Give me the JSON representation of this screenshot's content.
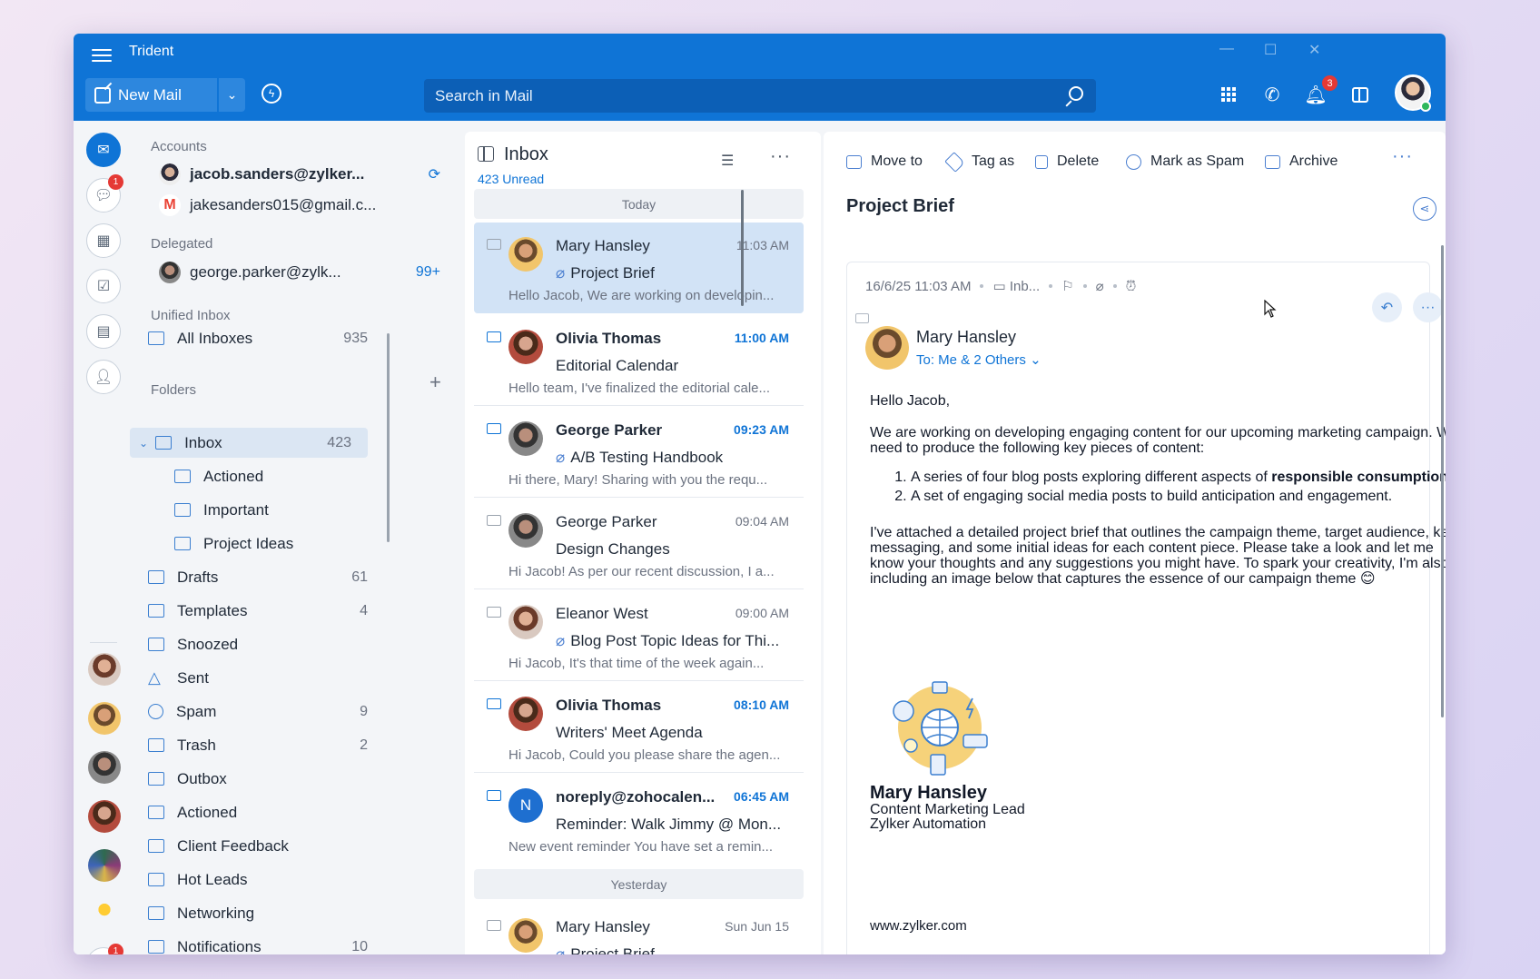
{
  "app": {
    "title": "Trident"
  },
  "toolbar": {
    "new_mail_label": "New Mail",
    "search_placeholder": "Search in Mail",
    "notification_count": "3"
  },
  "rail": {
    "chat_badge": "1",
    "bottom_badge": "1"
  },
  "accounts": {
    "header": "Accounts",
    "items": [
      {
        "label": "jacob.sanders@zylker...",
        "extra": ""
      },
      {
        "label": "jakesanders015@gmail.c...",
        "extra": ""
      }
    ]
  },
  "delegated": {
    "header": "Delegated",
    "items": [
      {
        "label": "george.parker@zylk...",
        "extra": "99+"
      }
    ]
  },
  "unified": {
    "header": "Unified Inbox",
    "items": [
      {
        "label": "All Inboxes",
        "count": "935"
      }
    ]
  },
  "folders": {
    "header": "Folders",
    "items": [
      {
        "label": "Inbox",
        "count": "423"
      },
      {
        "label": "Actioned",
        "count": ""
      },
      {
        "label": "Important",
        "count": ""
      },
      {
        "label": "Project Ideas",
        "count": ""
      },
      {
        "label": "Drafts",
        "count": "61"
      },
      {
        "label": "Templates",
        "count": "4"
      },
      {
        "label": "Snoozed",
        "count": ""
      },
      {
        "label": "Sent",
        "count": ""
      },
      {
        "label": "Spam",
        "count": "9"
      },
      {
        "label": "Trash",
        "count": "2"
      },
      {
        "label": "Outbox",
        "count": ""
      },
      {
        "label": "Actioned",
        "count": ""
      },
      {
        "label": "Client Feedback",
        "count": ""
      },
      {
        "label": "Hot Leads",
        "count": ""
      },
      {
        "label": "Networking",
        "count": ""
      },
      {
        "label": "Notifications",
        "count": "10"
      }
    ]
  },
  "list": {
    "title": "Inbox",
    "unread": "423 Unread",
    "today": "Today",
    "yesterday": "Yesterday",
    "messages": [
      {
        "from": "Mary Hansley",
        "time": "11:03 AM",
        "subject": "Project Brief",
        "preview": "Hello Jacob, We are working on developin..."
      },
      {
        "from": "Olivia Thomas",
        "time": "11:00 AM",
        "subject": "Editorial Calendar",
        "preview": "Hello team, I've finalized the editorial cale..."
      },
      {
        "from": "George Parker",
        "time": "09:23 AM",
        "subject": "A/B Testing Handbook",
        "preview": "Hi there, Mary! Sharing with you the requ..."
      },
      {
        "from": "George Parker",
        "time": "09:04 AM",
        "subject": "Design Changes",
        "preview": "Hi Jacob! As per our recent discussion, I a..."
      },
      {
        "from": "Eleanor West",
        "time": "09:00 AM",
        "subject": "Blog Post Topic Ideas for Thi...",
        "preview": "Hi Jacob, It's that time of the week again..."
      },
      {
        "from": "Olivia Thomas",
        "time": "08:10 AM",
        "subject": "Writers' Meet Agenda",
        "preview": "Hi Jacob, Could you please share the agen..."
      },
      {
        "from": "noreply@zohocalen...",
        "time": "06:45 AM",
        "subject": "Reminder: Walk Jimmy @ Mon...",
        "preview": "New event reminder You have set a remin...",
        "initial": "N"
      },
      {
        "from": "Mary Hansley",
        "time": "Sun Jun 15",
        "subject": "Project Brief",
        "preview": ""
      }
    ]
  },
  "reading": {
    "actions": {
      "move": "Move to",
      "tag": "Tag as",
      "delete": "Delete",
      "spam": "Mark as Spam",
      "archive": "Archive"
    },
    "title": "Project Brief",
    "meta_date": "16/6/25 11:03 AM",
    "meta_folder": "Inb...",
    "sender": "Mary Hansley",
    "to": "To: Me & 2 Others",
    "greeting": "Hello Jacob,",
    "para1": "We are working on developing engaging content for our upcoming marketing campaign. We'll need to produce the following key pieces of content:",
    "item1_pre": "A series of four blog posts exploring different aspects of ",
    "item1_bold": "responsible consumption",
    "item1_post": ".",
    "item2": "A set of engaging social media posts to build anticipation and engagement.",
    "para2": "I've attached a detailed project brief that outlines the campaign theme, target audience, key messaging, and some initial ideas for each content piece. Please take a look and let me know your thoughts and any suggestions you might have. To spark your creativity, I'm also including an image below that captures the essence of our campaign theme 😊",
    "sig_name": "Mary Hansley",
    "sig_role": "Content Marketing Lead",
    "sig_company": "Zylker Automation",
    "website": "www.zylker.com"
  }
}
